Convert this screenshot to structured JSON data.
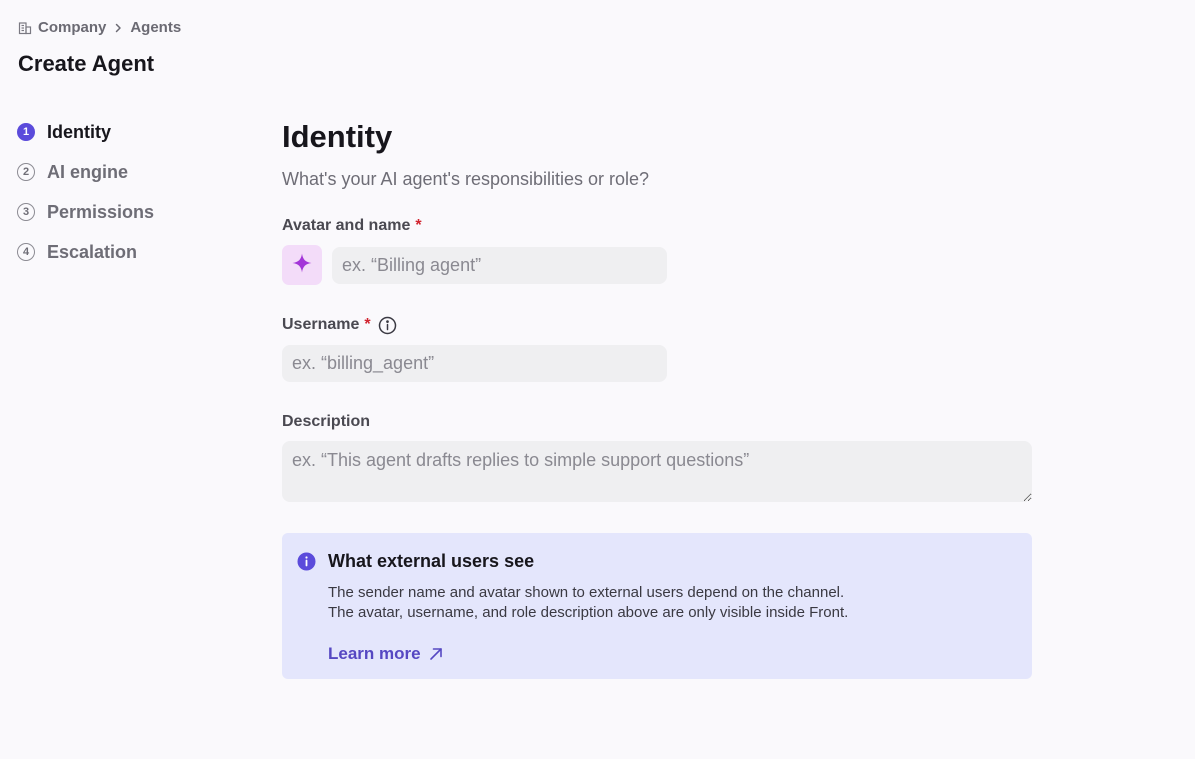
{
  "breadcrumb": {
    "items": [
      "Company",
      "Agents"
    ]
  },
  "page": {
    "title": "Create Agent"
  },
  "steps": [
    {
      "number": "1",
      "label": "Identity",
      "active": true
    },
    {
      "number": "2",
      "label": "AI engine",
      "active": false
    },
    {
      "number": "3",
      "label": "Permissions",
      "active": false
    },
    {
      "number": "4",
      "label": "Escalation",
      "active": false
    }
  ],
  "identity": {
    "title": "Identity",
    "subtitle": "What's your AI agent's responsibilities or role?",
    "avatar_name": {
      "label": "Avatar and name",
      "required_mark": "*",
      "avatar_icon": "sparkle-icon",
      "value": "",
      "placeholder": "ex. “Billing agent”"
    },
    "username": {
      "label": "Username",
      "required_mark": "*",
      "info_icon": "info-icon",
      "value": "",
      "placeholder": "ex. “billing_agent”"
    },
    "description": {
      "label": "Description",
      "value": "",
      "placeholder": "ex. “This agent drafts replies to simple support questions”"
    }
  },
  "callout": {
    "icon": "info-filled-icon",
    "title": "What external users see",
    "lines": [
      "The sender name and avatar shown to external users depend on the channel.",
      "The avatar, username, and role description above are only visible inside Front."
    ],
    "link_label": "Learn more",
    "link_icon": "arrow-up-right-icon"
  },
  "colors": {
    "accent": "#5b4bdb",
    "link": "#5648c2",
    "required": "#d1242f",
    "callout_bg": "#e4e6fc",
    "avatar_bg": "#f3dcf9",
    "sparkle": "#a335d8"
  }
}
